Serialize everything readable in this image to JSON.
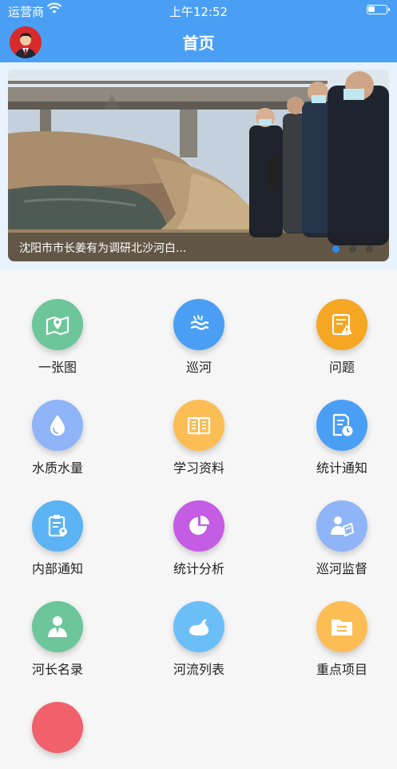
{
  "status_bar": {
    "carrier": "运营商",
    "time": "上午12:52"
  },
  "header": {
    "title": "首页"
  },
  "banner": {
    "caption": "沈阳市市长姜有为调研北沙河白...",
    "slide_count": 3,
    "active_slide": 1
  },
  "menu": [
    {
      "label": "一张图",
      "icon": "map-icon",
      "color": "#6cc69a"
    },
    {
      "label": "巡河",
      "icon": "wave-icon",
      "color": "#4a9ff5"
    },
    {
      "label": "问题",
      "icon": "warning-doc-icon",
      "color": "#f5a623"
    },
    {
      "label": "水质水量",
      "icon": "water-drop-icon",
      "color": "#8fb4f7"
    },
    {
      "label": "学习资料",
      "icon": "book-icon",
      "color": "#fbbd54"
    },
    {
      "label": "统计通知",
      "icon": "notice-clock-icon",
      "color": "#4a9ff5"
    },
    {
      "label": "内部通知",
      "icon": "clipboard-icon",
      "color": "#5cb3f3"
    },
    {
      "label": "统计分析",
      "icon": "pie-chart-icon",
      "color": "#c45de3"
    },
    {
      "label": "巡河监督",
      "icon": "supervisor-icon",
      "color": "#8fb4f7"
    },
    {
      "label": "河长名录",
      "icon": "person-icon",
      "color": "#6cc69a"
    },
    {
      "label": "河流列表",
      "icon": "river-icon",
      "color": "#6cbff6"
    },
    {
      "label": "重点项目",
      "icon": "folder-icon",
      "color": "#fbbd54"
    }
  ]
}
